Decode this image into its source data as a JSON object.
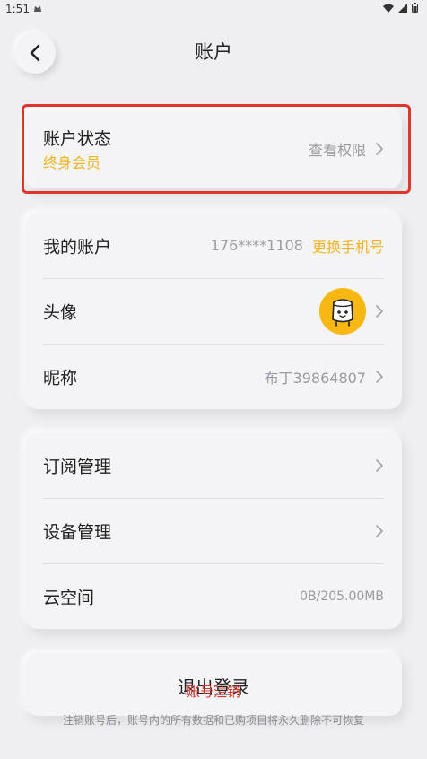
{
  "status_bar": {
    "time": "1:51"
  },
  "header": {
    "title": "账户"
  },
  "account_status": {
    "label": "账户状态",
    "value": "终身会员",
    "action": "查看权限"
  },
  "profile": {
    "account_label": "我的账户",
    "phone": "176****1108",
    "change_phone": "更换手机号",
    "avatar_label": "头像",
    "nickname_label": "昵称",
    "nickname": "布丁39864807"
  },
  "management": {
    "subscription_label": "订阅管理",
    "device_label": "设备管理",
    "cloud_label": "云空间",
    "cloud_usage": "0B/205.00MB"
  },
  "footer": {
    "logout_label": "退出登录",
    "cancel_account": "账号注销",
    "note": "注销账号后，账号内的所有数据和已购项目将永久删除不可恢复"
  },
  "colors": {
    "accent": "#f2b320",
    "danger": "#e0352b"
  }
}
